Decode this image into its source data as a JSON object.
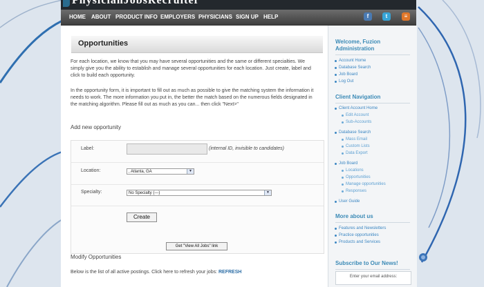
{
  "header": {
    "logo_text": "PhysicianJobsRecruiter"
  },
  "nav": {
    "items": [
      "HOME",
      "ABOUT",
      "PRODUCT INFO",
      "EMPLOYERS",
      "PHYSICIANS",
      "SIGN UP",
      "HELP"
    ],
    "social": [
      {
        "icon": "facebook-icon",
        "glyph": "f"
      },
      {
        "icon": "twitter-icon",
        "glyph": "t"
      },
      {
        "icon": "rss-icon",
        "glyph": "≡"
      }
    ]
  },
  "main": {
    "title": "Opportunities",
    "para1": "For each location, we know that you may have several opportunities and the same or different specialties. We simply give you the ability to establish and manage several opportunities for each location. Just create, label and click to build each opportunity.",
    "para2": "In the opportunity form, it is important to fill out as much as possible to give the matching system the information it needs to work. The more information you put in, the better the match based on the numerous fields designated in the matching algorithm. Please fill out as much as you can... then click \"Next>\"",
    "add_heading": "Add new opportunity",
    "form": {
      "label_label": "Label:",
      "label_value": "",
      "label_hint": "(internal ID, invisible to candidates)",
      "location_label": "Location:",
      "location_value": ", Atlanta, GA",
      "specialty_label": "Specialty:",
      "specialty_value": "No Specialty (---)",
      "create_button": "Create"
    },
    "view_all_button": "Get \"View All Jobs\" link",
    "modify_heading": "Modify Opportunities",
    "list_text": "Below is the list of all active postings. Click here to refresh your jobs:",
    "refresh_link": "REFRESH"
  },
  "sidebar": {
    "welcome": "Welcome, Fuzion Administration",
    "welcome_links": [
      "Account Home",
      "Database Search",
      "Job Board",
      "Log Out"
    ],
    "client_nav_title": "Client Navigation",
    "client_account_home": "Client Account Home",
    "client_account_sub": [
      "Edit Account",
      "Sub-Accounts"
    ],
    "database_search": "Database Search",
    "database_search_sub": [
      "Mass Email",
      "Custom Lists",
      "Data Export"
    ],
    "job_board": "Job Board",
    "job_board_sub": [
      "Locations",
      "Opportunities",
      "Manage opportunities",
      "Responses"
    ],
    "user_guide": "User Guide",
    "more_title": "More about us",
    "more_links": [
      "Features and Newsletters",
      "Practice opportunities",
      "Products and Services"
    ],
    "subscribe_title": "Subscribe to Our News!",
    "email_placeholder": "Enter your email address:"
  }
}
